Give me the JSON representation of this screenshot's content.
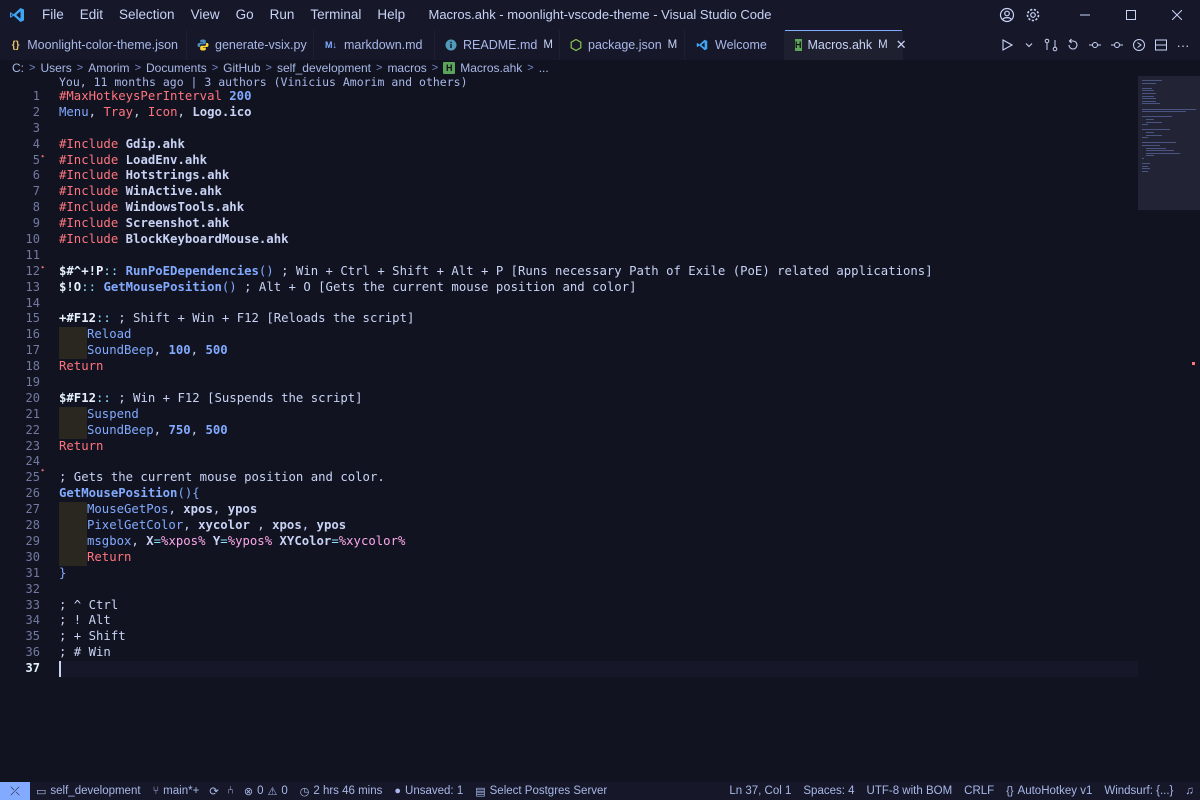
{
  "window": {
    "title": "Macros.ahk - moonlight-vscode-theme - Visual Studio Code"
  },
  "menu": [
    "File",
    "Edit",
    "Selection",
    "View",
    "Go",
    "Run",
    "Terminal",
    "Help"
  ],
  "tabs": [
    {
      "label": "Moonlight-color-theme.json",
      "icon": "json-icon",
      "modified": ""
    },
    {
      "label": "generate-vsix.py",
      "icon": "python-icon",
      "modified": ""
    },
    {
      "label": "markdown.md",
      "icon": "markdown-icon",
      "modified": ""
    },
    {
      "label": "README.md",
      "icon": "info-icon",
      "modified": "M"
    },
    {
      "label": "package.json",
      "icon": "nodejs-icon",
      "modified": "M"
    },
    {
      "label": "Welcome",
      "icon": "vscode-icon",
      "modified": ""
    },
    {
      "label": "Macros.ahk",
      "icon": "ahk-icon",
      "modified": "M",
      "active": true
    }
  ],
  "breadcrumb": [
    "C:",
    "Users",
    "Amorim",
    "Documents",
    "GitHub",
    "self_development",
    "macros",
    "Macros.ahk",
    "..."
  ],
  "blame": "You, 11 months ago | 3 authors (Vinicius Amorim and others)",
  "line_numbers": [
    "1",
    "2",
    "3",
    "4",
    "5",
    "6",
    "7",
    "8",
    "9",
    "10",
    "11",
    "12",
    "13",
    "14",
    "15",
    "16",
    "17",
    "18",
    "19",
    "20",
    "21",
    "22",
    "23",
    "24",
    "25",
    "26",
    "27",
    "28",
    "29",
    "30",
    "31",
    "32",
    "33",
    "34",
    "35",
    "36",
    "37"
  ],
  "code": {
    "l1": {
      "a": "#MaxHotkeysPerInterval",
      "b": "200"
    },
    "l2": {
      "a": "Menu",
      "b": ", ",
      "c": "Tray",
      "d": ", ",
      "e": "Icon",
      "f": ", ",
      "g": "Logo.ico"
    },
    "include_kw": "#Include",
    "includes": [
      "Gdip.ahk",
      "LoadEnv.ahk",
      "Hotstrings.ahk",
      "WinActive.ahk",
      "WindowsTools.ahk",
      "Screenshot.ahk",
      "BlockKeyboardMouse.ahk"
    ],
    "l12": {
      "hk": "$#^+!P",
      "sep": "::",
      "fn": "RunPoEDependencies",
      "paren": "()",
      "cm": " ; Win + Ctrl + Shift + Alt + P [Runs necessary Path of Exile (PoE) related applications]"
    },
    "l13": {
      "hk": "$!O",
      "sep": "::",
      "fn": "GetMousePosition",
      "paren": "()",
      "cm": " ; Alt + O [Gets the current mouse position and color]"
    },
    "l15": {
      "hk": "+#F12",
      "sep": "::",
      "cm": " ; Shift + Win + F12 [Reloads the script]"
    },
    "l16": "Reload",
    "l17": {
      "fn": "SoundBeep",
      "c1": ", ",
      "n1": "100",
      "c2": ", ",
      "n2": "500"
    },
    "l18": "Return",
    "l20": {
      "hk": "$#F12",
      "sep": "::",
      "cm": " ; Win + F12 [Suspends the script]"
    },
    "l21": "Suspend",
    "l22": {
      "fn": "SoundBeep",
      "c1": ", ",
      "n1": "750",
      "c2": ", ",
      "n2": "500"
    },
    "l23": "Return",
    "l25": "; Gets the current mouse position and color.",
    "l26": {
      "fn": "GetMousePosition",
      "paren": "()",
      "brace": "{"
    },
    "l27": {
      "fn": "MouseGetPos",
      "c1": ", ",
      "v1": "xpos",
      "c2": ", ",
      "v2": "ypos"
    },
    "l28": {
      "fn": "PixelGetColor",
      "c1": ", ",
      "v1": "xycolor",
      "c2": " , ",
      "v2": "xpos",
      "c3": ", ",
      "v3": "ypos"
    },
    "l29": {
      "fn": "msgbox",
      "c1": ", ",
      "a": "X",
      "eq1": "=",
      "p1": "%xpos%",
      "b": " Y",
      "eq2": "=",
      "p2": "%ypos%",
      "c": " XYColor",
      "eq3": "=",
      "p3": "%xycolor%"
    },
    "l30": "Return",
    "l31": "}",
    "l33": "; ^ Ctrl",
    "l34": "; ! Alt",
    "l35": "; + Shift",
    "l36": "; # Win"
  },
  "status": {
    "branch_repo": "self_development",
    "branch": "main*+",
    "errors": "0",
    "warnings": "0",
    "time": "2 hrs 46 mins",
    "unsaved": "Unsaved: 1",
    "postgres": "Select Postgres Server",
    "position": "Ln 37, Col 1",
    "spaces": "Spaces: 4",
    "encoding": "UTF-8 with BOM",
    "eol": "CRLF",
    "language": "AutoHotkey v1",
    "windsurf": "Windsurf: {...}"
  },
  "colors": {
    "background": "#111320",
    "keyword": "#ff757f",
    "function": "#82aaff",
    "accent": "#82aaff"
  }
}
